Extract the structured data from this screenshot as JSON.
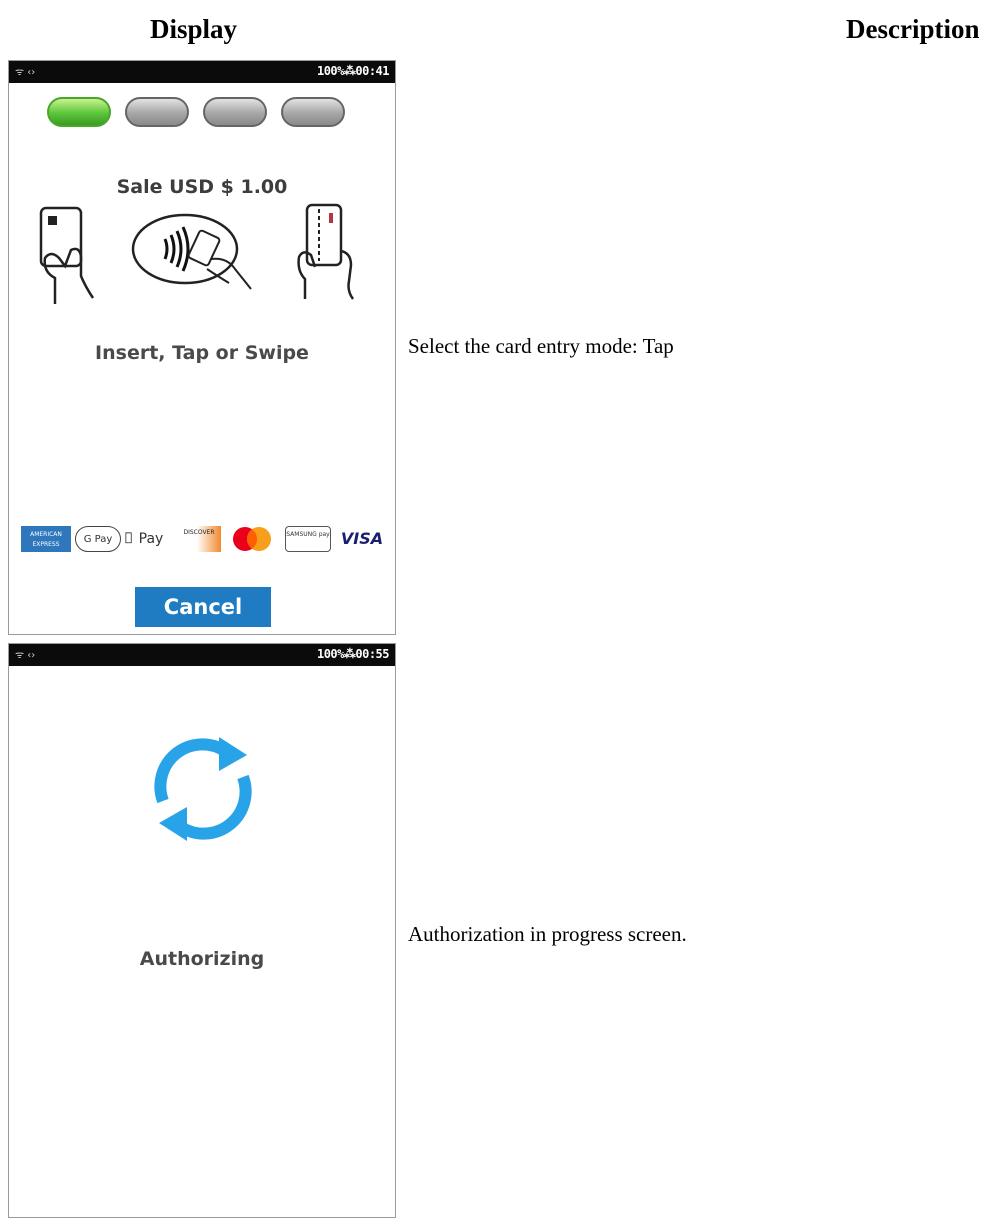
{
  "columns": {
    "display": "Display",
    "description": "Description"
  },
  "rows": [
    {
      "status": {
        "left": "ᯤ ‹›",
        "right": "100%⁂00:41"
      },
      "progress": [
        {
          "label": "step 1",
          "state": "active"
        },
        {
          "label": "step 2",
          "state": "inactive"
        },
        {
          "label": "step 3",
          "state": "inactive"
        },
        {
          "label": "step 4",
          "state": "inactive"
        }
      ],
      "sale": "Sale USD $ 1.00",
      "instruction": "Insert, Tap or Swipe",
      "brands": [
        "AMERICAN EXPRESS",
        "G Pay",
        "Pay",
        "DISCOVER",
        "mastercard",
        "SAMSUNG pay",
        "VISA"
      ],
      "cancel": "Cancel",
      "description": "Select the card entry mode: Tap"
    },
    {
      "status": {
        "left": "ᯤ ‹›",
        "right": "100%⁂00:55"
      },
      "message": "Authorizing",
      "description": "Authorization in progress screen."
    }
  ],
  "colors": {
    "accent": "#1f7cc2",
    "spinner": "#29a3e8",
    "active_step": "#5cc53a"
  }
}
